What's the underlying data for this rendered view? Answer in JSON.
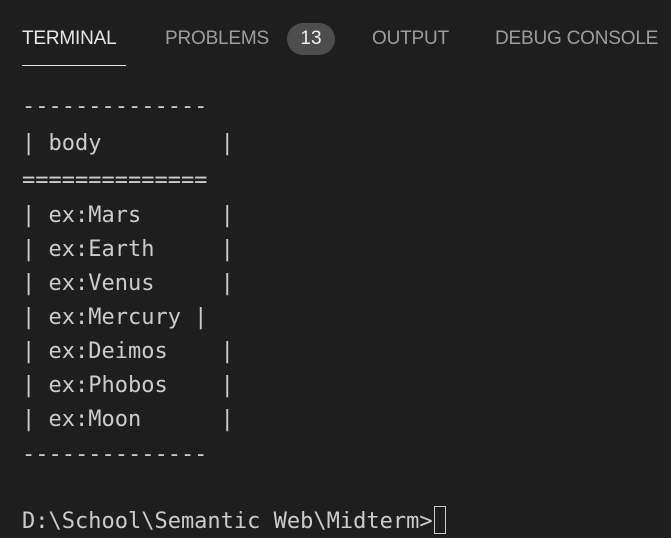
{
  "tabs": [
    {
      "label": "TERMINAL",
      "active": true
    },
    {
      "label": "PROBLEMS",
      "badge": "13"
    },
    {
      "label": "OUTPUT"
    },
    {
      "label": "DEBUG CONSOLE"
    }
  ],
  "terminal": {
    "lines": [
      "--------------",
      "| body         |",
      "==============",
      "| ex:Mars      |",
      "| ex:Earth     |",
      "| ex:Venus     |",
      "| ex:Mercury |",
      "| ex:Deimos    |",
      "| ex:Phobos    |",
      "| ex:Moon      |",
      "--------------",
      "",
      "D:\\School\\Semantic Web\\Midterm>"
    ]
  },
  "colors": {
    "background": "#1e1e1e",
    "text": "#cccccc",
    "active_tab": "#e7e7e7",
    "inactive_tab": "#9d9d9d",
    "badge_bg": "#4d4d4d"
  }
}
